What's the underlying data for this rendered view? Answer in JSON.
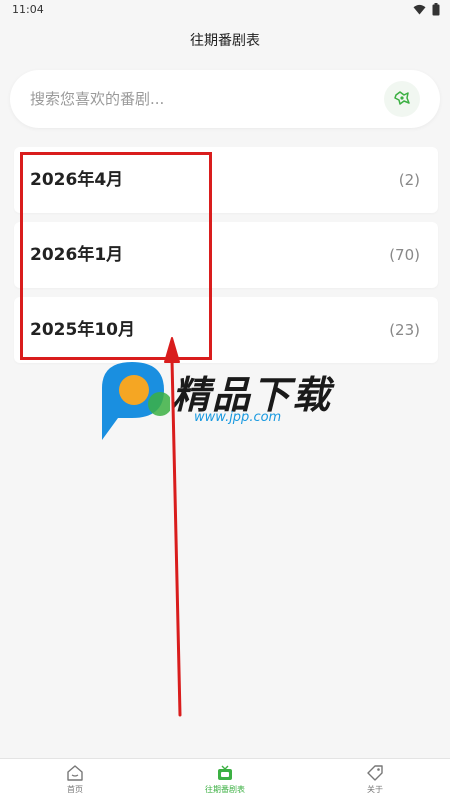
{
  "status_bar": {
    "time": "11:04"
  },
  "header": {
    "title": "往期番剧表"
  },
  "search": {
    "placeholder": "搜索您喜欢的番剧..."
  },
  "seasons": [
    {
      "title": "2026年4月",
      "count": "(2)"
    },
    {
      "title": "2026年1月",
      "count": "(70)"
    },
    {
      "title": "2025年10月",
      "count": "(23)"
    }
  ],
  "watermark": {
    "text": "精品下载",
    "url": "www.jpp.com"
  },
  "bottom_nav": {
    "items": [
      {
        "label": "首页",
        "icon": "home-icon",
        "active": false
      },
      {
        "label": "往期番剧表",
        "icon": "tv-icon",
        "active": true
      },
      {
        "label": "关于",
        "icon": "tag-icon",
        "active": false
      }
    ]
  },
  "colors": {
    "accent": "#3cb043",
    "annotation_red": "#d91d1d",
    "background": "#f6f6f6"
  }
}
